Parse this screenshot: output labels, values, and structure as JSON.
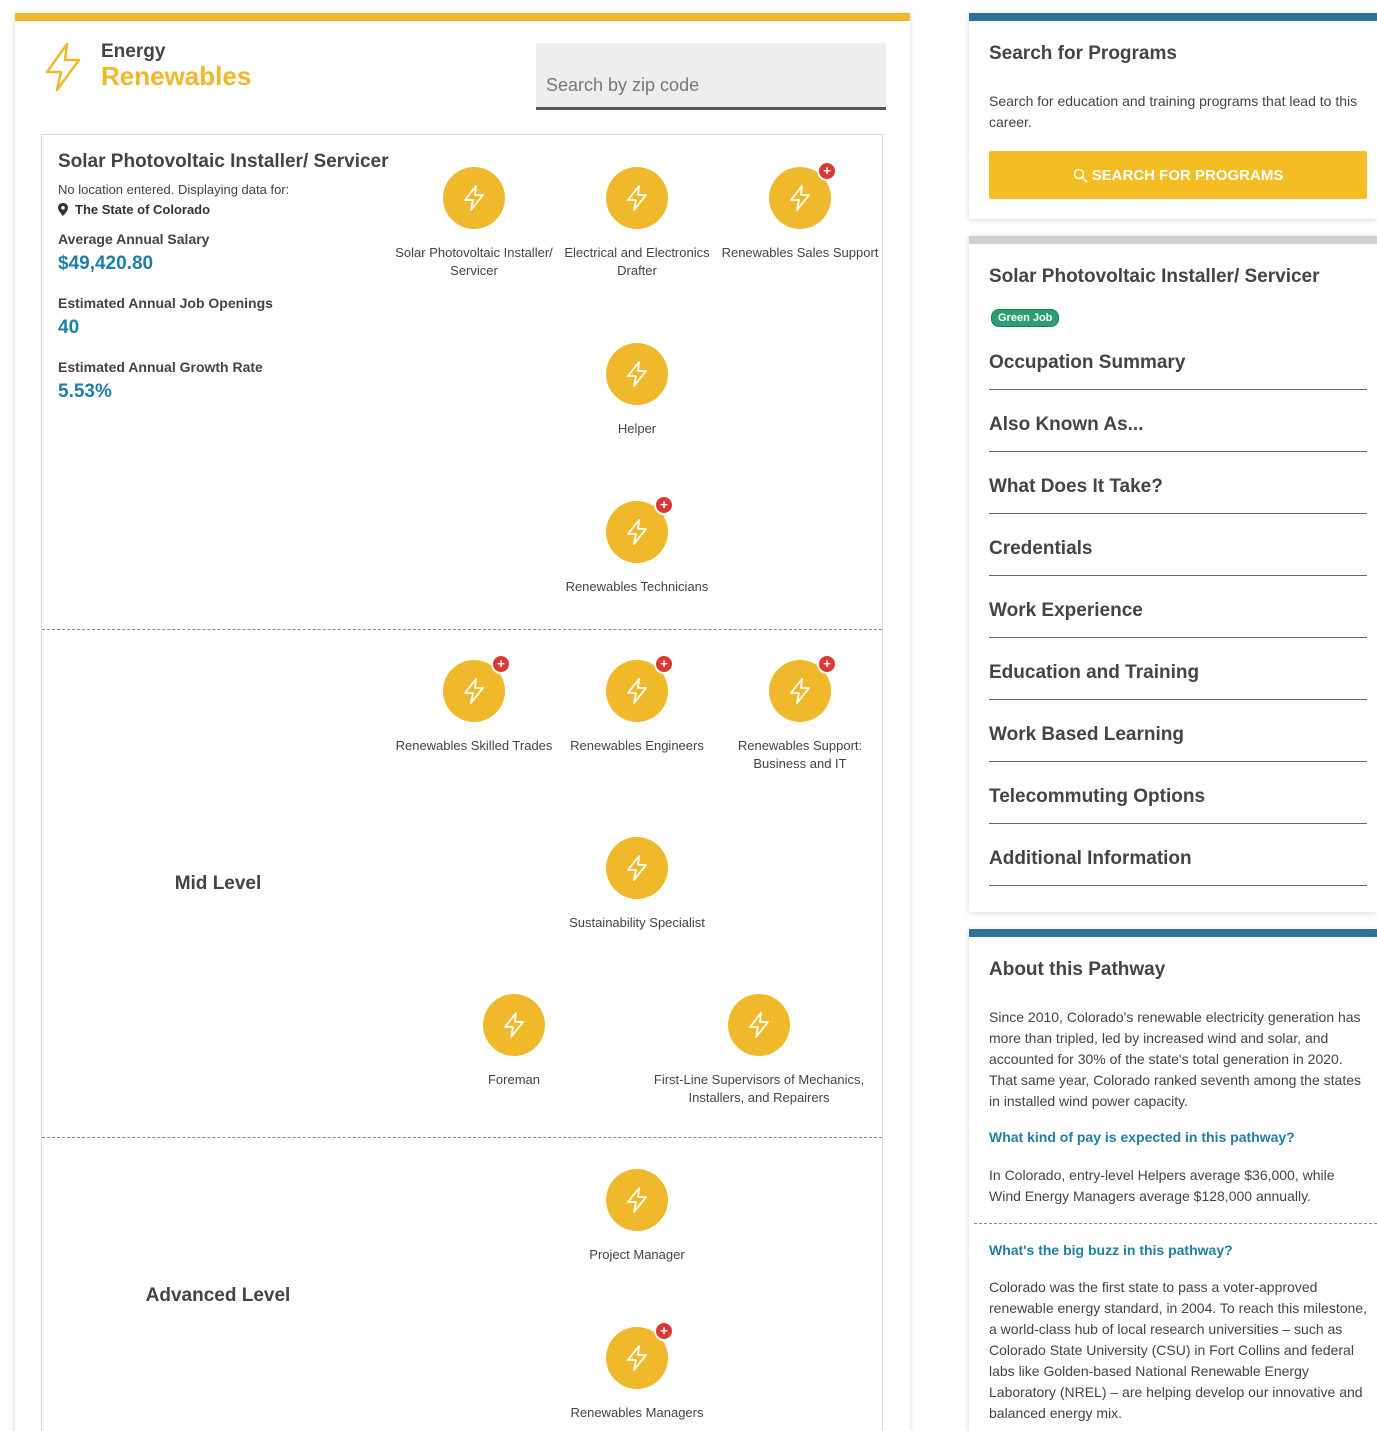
{
  "brand": {
    "line1": "Energy",
    "line2": "Renewables",
    "icon": "lightning-bolt-icon"
  },
  "search": {
    "placeholder": "Search by zip code"
  },
  "occupation": {
    "title": "Solar Photovoltaic Installer/ Servicer",
    "location_note": "No location entered. Displaying data for:",
    "location": "The State of Colorado",
    "salary_label": "Average Annual Salary",
    "salary_value": "$49,420.80",
    "openings_label": "Estimated Annual Job Openings",
    "openings_value": "40",
    "growth_label": "Estimated Annual Growth Rate",
    "growth_value": "5.53%"
  },
  "levels": {
    "mid": "Mid Level",
    "advanced": "Advanced Level"
  },
  "nodes": {
    "solar": "Solar Photovoltaic Installer/ Servicer",
    "drafter": "Electrical and Electronics Drafter",
    "sales": "Renewables Sales Support",
    "helper": "Helper",
    "technicians": "Renewables Technicians",
    "skilled": "Renewables Skilled Trades",
    "engineers": "Renewables Engineers",
    "support_it": "Renewables Support: Business and IT",
    "sustainability": "Sustainability Specialist",
    "foreman": "Foreman",
    "supervisors": "First-Line Supervisors of Mechanics, Installers, and Repairers",
    "pm": "Project Manager",
    "managers": "Renewables Managers",
    "plus": "+"
  },
  "search_programs": {
    "title": "Search for Programs",
    "text": "Search for education and training programs that lead to this career.",
    "button": "SEARCH FOR PROGRAMS"
  },
  "details": {
    "title": "Solar Photovoltaic Installer/ Servicer",
    "badge": "Green Job",
    "sections": [
      "Occupation Summary",
      "Also Known As...",
      "What Does It Take?",
      "Credentials",
      "Work Experience",
      "Education and Training",
      "Work Based Learning",
      "Telecommuting Options",
      "Additional Information"
    ]
  },
  "about": {
    "title": "About this Pathway",
    "p1": "Since 2010, Colorado's renewable electricity generation has more than tripled, led by increased wind and solar, and accounted for 30% of the state's total generation in 2020. That same year, Colorado ranked seventh among the states in installed wind power capacity.",
    "q1": "What kind of pay is expected in this pathway?",
    "p2": "In Colorado, entry-level Helpers average $36,000, while Wind Energy Managers average $128,000 annually.",
    "q2": "What's the big buzz in this pathway?",
    "p3": "Colorado was the first state to pass a voter-approved renewable energy standard, in 2004. To reach this milestone, a world-class hub of local research universities – such as Colorado State University (CSU) in Fort Collins and federal labs like Golden-based National Renewable Energy Laboratory (NREL) – are helping develop our innovative and balanced energy mix."
  },
  "colors": {
    "accent": "#f0b92b",
    "link": "#1f7fa4",
    "header_blue": "#2f7296",
    "badge_red": "#d93b34",
    "green": "#2aa072"
  }
}
